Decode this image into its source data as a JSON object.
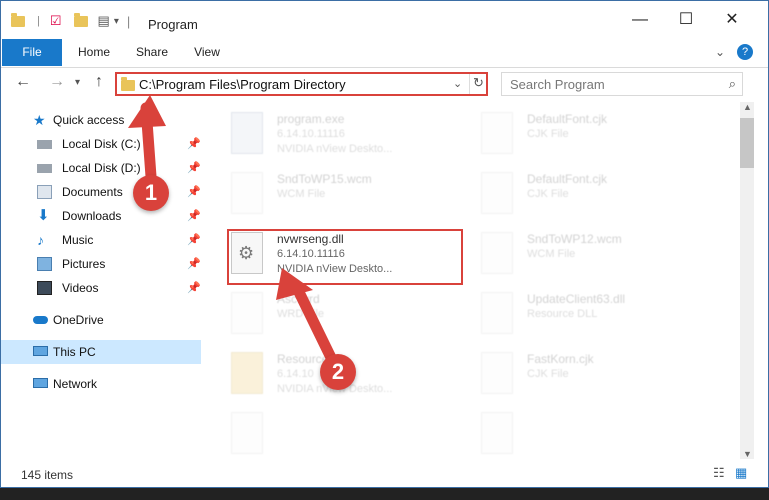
{
  "window": {
    "title": "Program"
  },
  "window_controls": {
    "minimize": "—",
    "maximize": "☐",
    "close": "✕"
  },
  "ribbon": {
    "tabs": [
      "File",
      "Home",
      "Share",
      "View"
    ]
  },
  "address": {
    "path": "C:\\Program Files\\Program Directory",
    "search_placeholder": "Search Program"
  },
  "nav": {
    "items": [
      {
        "label": "Quick access",
        "icon": "star-icon"
      },
      {
        "label": "Local Disk (C:)",
        "icon": "drive-icon",
        "pinned": true
      },
      {
        "label": "Local Disk (D:)",
        "icon": "drive-icon",
        "pinned": true
      },
      {
        "label": "Documents",
        "icon": "documents-icon",
        "pinned": true
      },
      {
        "label": "Downloads",
        "icon": "downloads-icon",
        "pinned": true
      },
      {
        "label": "Music",
        "icon": "music-icon",
        "pinned": true
      },
      {
        "label": "Pictures",
        "icon": "pictures-icon",
        "pinned": true
      },
      {
        "label": "Videos",
        "icon": "videos-icon",
        "pinned": true
      },
      {
        "label": "OneDrive",
        "icon": "onedrive-icon"
      },
      {
        "label": "This PC",
        "icon": "computer-icon",
        "selected": true
      },
      {
        "label": "Network",
        "icon": "network-icon"
      }
    ]
  },
  "files": [
    {
      "name": "program.exe",
      "line2": "6.14.10.11116",
      "line3": "NVIDIA nView Deskto..."
    },
    {
      "name": "DefaultFont.cjk",
      "line2": "CJK File",
      "line3": ""
    },
    {
      "name": "SndToWP15.wcm",
      "line2": "WCM File",
      "line3": ""
    },
    {
      "name": "DefaultFont.cjk",
      "line2": "CJK File",
      "line3": ""
    },
    {
      "name": "nvwrseng.dll",
      "line2": "6.14.10.11116",
      "line3": "NVIDIA nView Deskto...",
      "highlighted": true
    },
    {
      "name": "SndToWP12.wcm",
      "line2": "WCM File",
      "line3": ""
    },
    {
      "name": "Asc.wrd",
      "line2": "WRD File",
      "line3": ""
    },
    {
      "name": "UpdateClient63.dll",
      "line2": "Resource DLL",
      "line3": ""
    },
    {
      "name": "Resource",
      "line2": "6.14.10",
      "line3": "NVIDIA nView Deskto..."
    },
    {
      "name": "FastKorn.cjk",
      "line2": "CJK File",
      "line3": ""
    }
  ],
  "status": {
    "items_count": "145 items"
  },
  "annotations": {
    "badge1": "1",
    "badge2": "2"
  },
  "colors": {
    "accent": "#1979ca",
    "annotation_red": "#d9423b",
    "selected_bg": "#cce8ff"
  }
}
